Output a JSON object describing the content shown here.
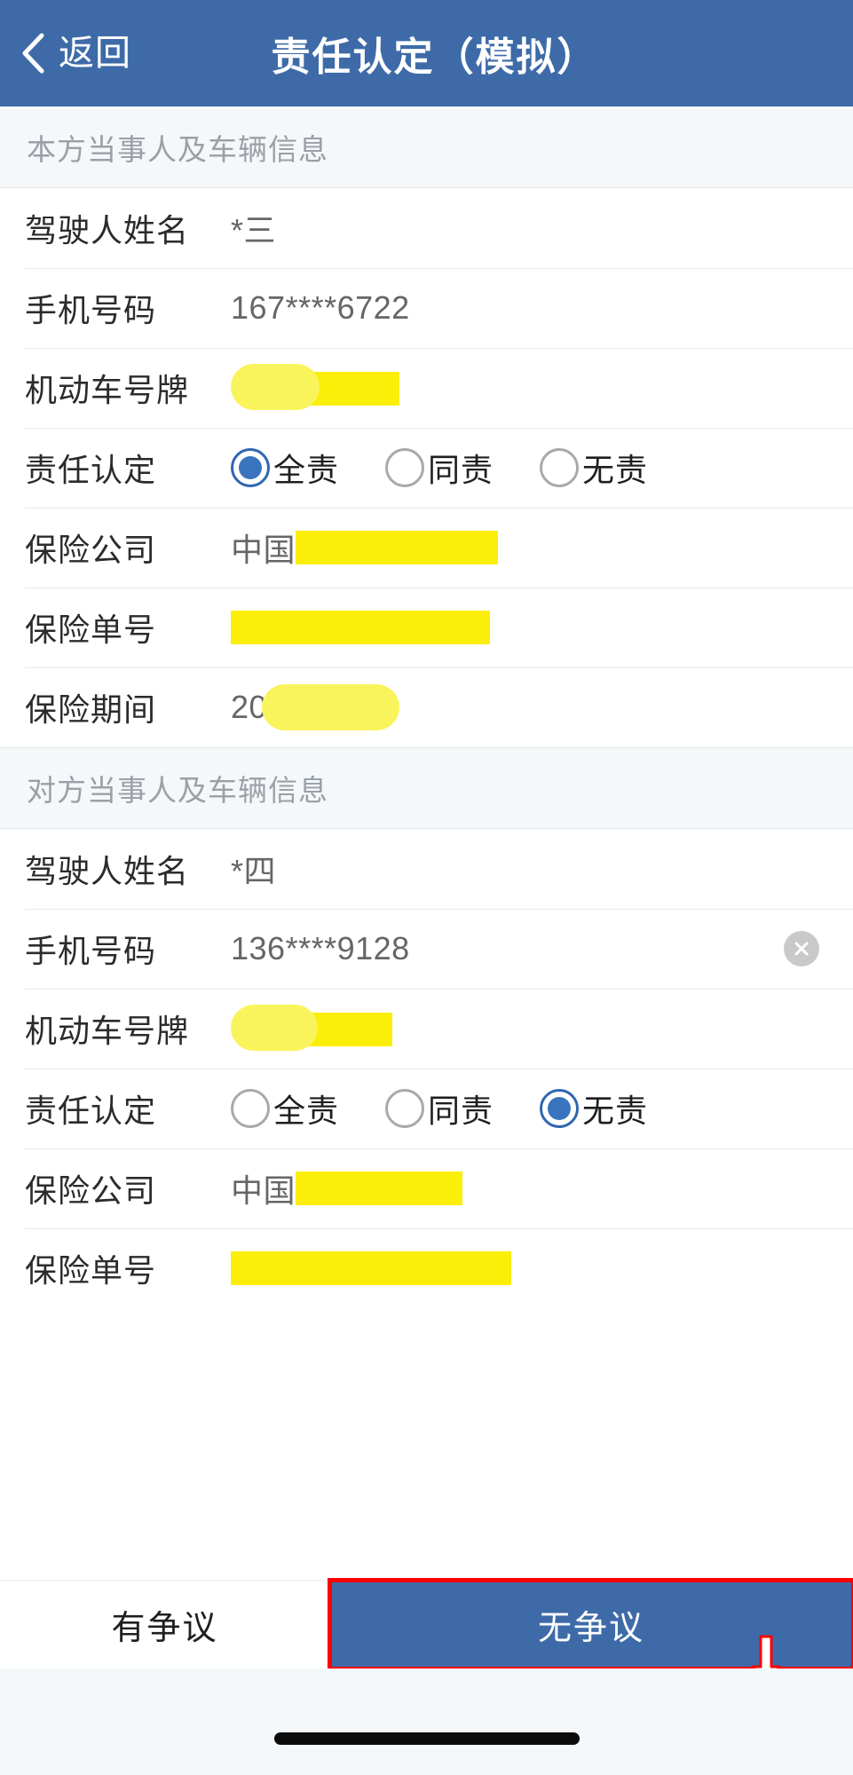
{
  "header": {
    "back_label": "返回",
    "title": "责任认定（模拟）",
    "back_icon": "chevron-left-icon",
    "bg_color": "#3e6ba8"
  },
  "sections": [
    {
      "id": "self-party",
      "title": "本方当事人及车辆信息",
      "rows": [
        {
          "label": "驾驶人姓名",
          "value": "*三",
          "type": "text"
        },
        {
          "label": "手机号码",
          "value": "167****6722",
          "type": "text"
        },
        {
          "label": "机动车号牌",
          "value": "",
          "type": "redacted-plate"
        },
        {
          "label": "责任认定",
          "type": "radio",
          "options": [
            "全责",
            "同责",
            "无责"
          ],
          "selected": "全责"
        },
        {
          "label": "保险公司",
          "value": "中国",
          "type": "redacted-suffix"
        },
        {
          "label": "保险单号",
          "value": "",
          "type": "redacted-full"
        },
        {
          "label": "保险期间",
          "value": "20",
          "type": "redacted-round"
        }
      ]
    },
    {
      "id": "other-party",
      "title": "对方当事人及车辆信息",
      "rows": [
        {
          "label": "驾驶人姓名",
          "value": "*四",
          "type": "text"
        },
        {
          "label": "手机号码",
          "value": "136****9128",
          "type": "text-clearable",
          "clear_icon": "close-circle-icon"
        },
        {
          "label": "机动车号牌",
          "value": "",
          "type": "redacted-plate"
        },
        {
          "label": "责任认定",
          "type": "radio",
          "options": [
            "全责",
            "同责",
            "无责"
          ],
          "selected": "无责"
        },
        {
          "label": "保险公司",
          "value": "中国",
          "type": "redacted-suffix"
        },
        {
          "label": "保险单号",
          "value": "",
          "type": "redacted-full"
        }
      ]
    }
  ],
  "action_bar": {
    "secondary_label": "有争议",
    "primary_label": "无争议",
    "primary_color": "#3e6ba8",
    "highlight_color": "#ff0000",
    "annotation_icon": "down-arrow-icon"
  },
  "system": {
    "home_indicator": "home-indicator"
  }
}
